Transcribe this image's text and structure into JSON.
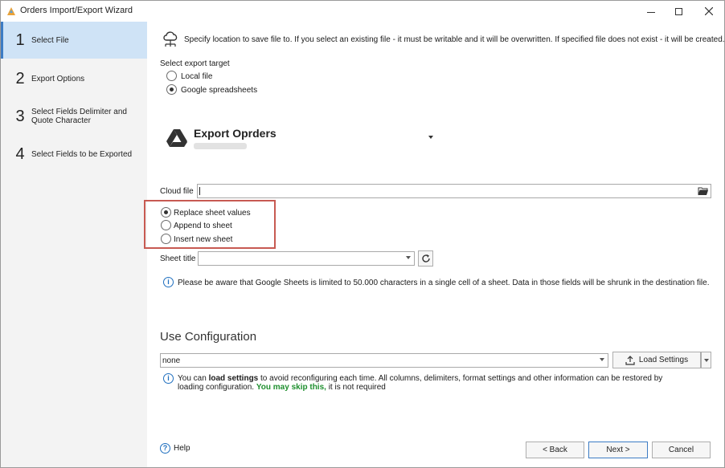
{
  "window": {
    "title": "Orders Import/Export Wizard"
  },
  "sidebar": {
    "steps": [
      {
        "num": "1",
        "label": "Select File"
      },
      {
        "num": "2",
        "label": "Export Options"
      },
      {
        "num": "3",
        "label": "Select Fields Delimiter and Quote Character"
      },
      {
        "num": "4",
        "label": "Select Fields to be Exported"
      }
    ]
  },
  "main": {
    "description": "Specify location to save file to. If you select an existing file - it must be writable and it will be overwritten. If specified file does not exist - it will be created.",
    "target_label": "Select export target",
    "target_options": [
      "Local file",
      "Google spreadsheets"
    ],
    "selected_target": "Google spreadsheets",
    "account_name": "Export Oprders",
    "cloud_file_label": "Cloud file",
    "cloud_file_value": "",
    "sheet_modes": [
      "Replace sheet values",
      "Append to sheet",
      "Insert new sheet"
    ],
    "selected_sheet_mode": "Replace sheet values",
    "sheet_title_label": "Sheet title",
    "sheet_title_value": "",
    "limit_note": "Please be aware that Google Sheets is limited to 50.000 characters in a single cell of a sheet. Data in those fields will be shrunk in the destination file."
  },
  "config": {
    "heading": "Use Configuration",
    "select_value": "none",
    "load_button": "Load Settings",
    "info_part1": "You can ",
    "info_bold": "load settings",
    "info_part2": " to avoid reconfiguring each time. All columns, delimiters, format settings and other information can be restored by loading configuration. ",
    "info_green": "You may skip this,",
    "info_part3": " it is not required"
  },
  "footer": {
    "help": "Help",
    "back": "< Back",
    "next": "Next >",
    "cancel": "Cancel"
  },
  "colors": {
    "accent": "#3d7cc4",
    "highlight": "#c75a52",
    "green_text": "#1e8f2e",
    "sidebar_active": "#cfe3f6"
  }
}
